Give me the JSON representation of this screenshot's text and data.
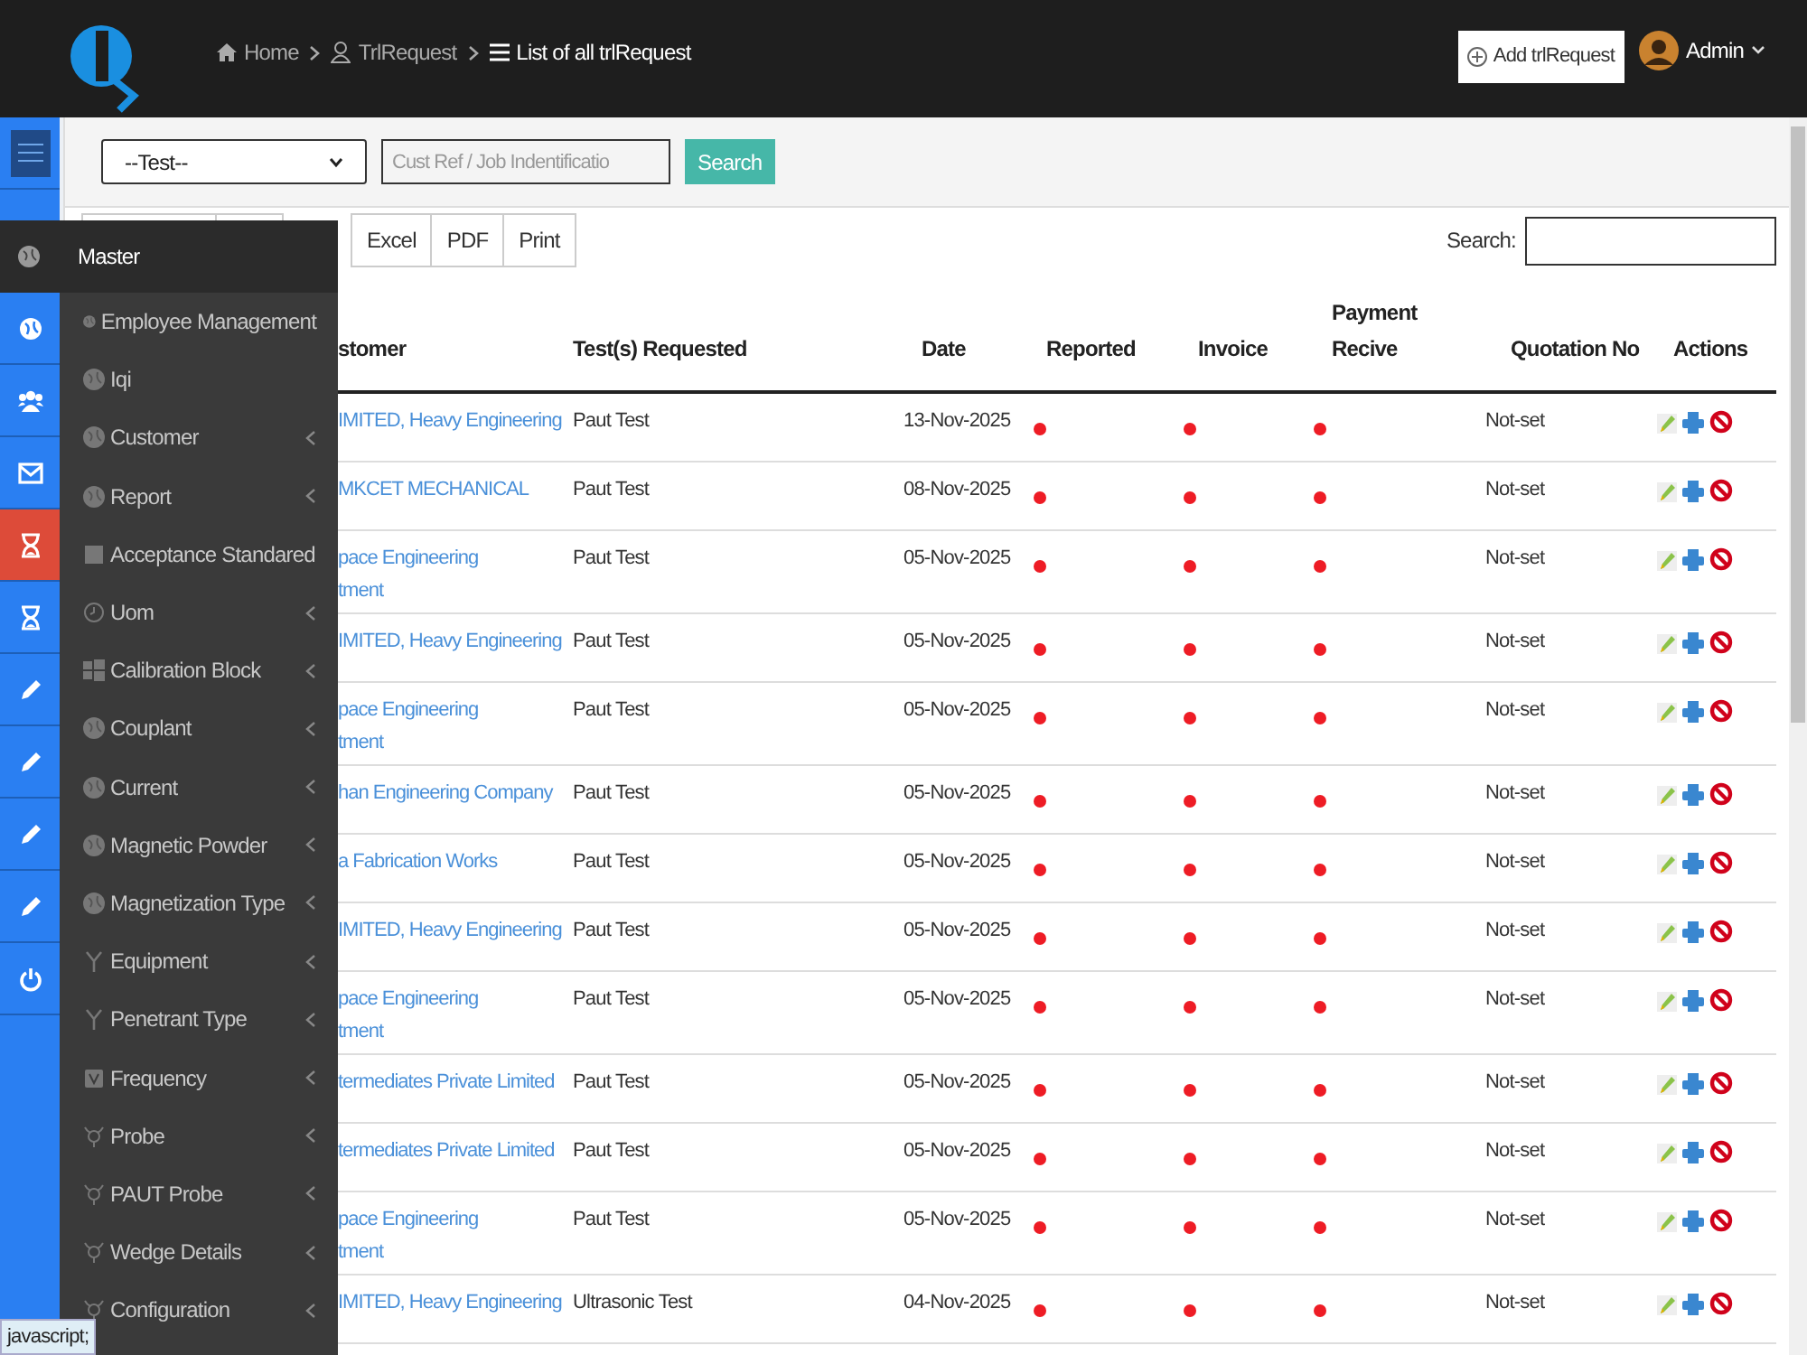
{
  "breadcrumbs": [
    {
      "label": "Home",
      "kind": "home",
      "current": false
    },
    {
      "label": "TrlRequest",
      "kind": "user",
      "current": false
    },
    {
      "label": "List of all trlRequest",
      "kind": "list",
      "current": true
    }
  ],
  "add_button": "Add trlRequest",
  "user": {
    "name": "Admin"
  },
  "rail": [
    {
      "kind": "globe",
      "selected": false
    },
    {
      "kind": "users",
      "selected": false
    },
    {
      "kind": "mail",
      "selected": false
    },
    {
      "kind": "hourglass",
      "selected": true
    },
    {
      "kind": "hourglass",
      "selected": false
    },
    {
      "kind": "pencil",
      "selected": false
    },
    {
      "kind": "pencil",
      "selected": false
    },
    {
      "kind": "pencil",
      "selected": false
    },
    {
      "kind": "pencil",
      "selected": false
    },
    {
      "kind": "power",
      "selected": false
    }
  ],
  "menu": {
    "title": "Master",
    "items": [
      {
        "label": "Employee Management",
        "kind": "globe",
        "submenu": false
      },
      {
        "label": "Iqi",
        "kind": "globe",
        "submenu": false
      },
      {
        "label": "Customer",
        "kind": "globe",
        "submenu": true
      },
      {
        "label": "Report",
        "kind": "globe",
        "submenu": true
      },
      {
        "label": "Acceptance Standared",
        "kind": "square",
        "submenu": false
      },
      {
        "label": "Uom",
        "kind": "clock",
        "submenu": true
      },
      {
        "label": "Calibration Block",
        "kind": "windows",
        "submenu": true
      },
      {
        "label": "Couplant",
        "kind": "globe",
        "submenu": true
      },
      {
        "label": "Current",
        "kind": "globe",
        "submenu": true
      },
      {
        "label": "Magnetic Powder",
        "kind": "globe",
        "submenu": true
      },
      {
        "label": "Magnetization Type",
        "kind": "globe",
        "submenu": true
      },
      {
        "label": "Equipment",
        "kind": "fork",
        "submenu": true
      },
      {
        "label": "Penetrant Type",
        "kind": "fork",
        "submenu": true
      },
      {
        "label": "Frequency",
        "kind": "badge",
        "submenu": true
      },
      {
        "label": "Probe",
        "kind": "bulb",
        "submenu": true
      },
      {
        "label": "PAUT Probe",
        "kind": "bulb",
        "submenu": true
      },
      {
        "label": "Wedge Details",
        "kind": "bulb",
        "submenu": true
      },
      {
        "label": "Configuration",
        "kind": "bulb",
        "submenu": true
      }
    ]
  },
  "filters": {
    "select": "--Test--",
    "placeholder": "Cust Ref / Job Indentificatio",
    "button": "Search"
  },
  "export_buttons": [
    "Excel",
    "PDF",
    "Print"
  ],
  "table_search": {
    "label": "Search:"
  },
  "table": {
    "columns": [
      "stomer",
      "Test(s) Requested",
      "Date",
      "Reported",
      "Invoice",
      "Payment Recive",
      "Quotation No",
      "Actions"
    ],
    "rows": [
      {
        "customer": [
          "IMITED, Heavy Engineering"
        ],
        "tests": "Paut Test",
        "date": "13-Nov-2025",
        "reported": false,
        "invoice": false,
        "payment": false,
        "quotation": "Not-set"
      },
      {
        "customer": [
          "MKCET MECHANICAL"
        ],
        "tests": "Paut Test",
        "date": "08-Nov-2025",
        "reported": false,
        "invoice": false,
        "payment": false,
        "quotation": "Not-set"
      },
      {
        "customer": [
          "pace Engineering",
          "tment"
        ],
        "tests": "Paut Test",
        "date": "05-Nov-2025",
        "reported": false,
        "invoice": false,
        "payment": false,
        "quotation": "Not-set"
      },
      {
        "customer": [
          "IMITED, Heavy Engineering"
        ],
        "tests": "Paut Test",
        "date": "05-Nov-2025",
        "reported": false,
        "invoice": false,
        "payment": false,
        "quotation": "Not-set"
      },
      {
        "customer": [
          "pace Engineering",
          "tment"
        ],
        "tests": "Paut Test",
        "date": "05-Nov-2025",
        "reported": false,
        "invoice": false,
        "payment": false,
        "quotation": "Not-set"
      },
      {
        "customer": [
          "han Engineering Company"
        ],
        "tests": "Paut Test",
        "date": "05-Nov-2025",
        "reported": false,
        "invoice": false,
        "payment": false,
        "quotation": "Not-set"
      },
      {
        "customer": [
          "a Fabrication Works"
        ],
        "tests": "Paut Test",
        "date": "05-Nov-2025",
        "reported": false,
        "invoice": false,
        "payment": false,
        "quotation": "Not-set"
      },
      {
        "customer": [
          "IMITED, Heavy Engineering"
        ],
        "tests": "Paut Test",
        "date": "05-Nov-2025",
        "reported": false,
        "invoice": false,
        "payment": false,
        "quotation": "Not-set"
      },
      {
        "customer": [
          "pace Engineering",
          "tment"
        ],
        "tests": "Paut Test",
        "date": "05-Nov-2025",
        "reported": false,
        "invoice": false,
        "payment": false,
        "quotation": "Not-set"
      },
      {
        "customer": [
          "termediates Private Limited"
        ],
        "tests": "Paut Test",
        "date": "05-Nov-2025",
        "reported": false,
        "invoice": false,
        "payment": false,
        "quotation": "Not-set"
      },
      {
        "customer": [
          "termediates Private Limited"
        ],
        "tests": "Paut Test",
        "date": "05-Nov-2025",
        "reported": false,
        "invoice": false,
        "payment": false,
        "quotation": "Not-set"
      },
      {
        "customer": [
          "pace Engineering",
          "tment"
        ],
        "tests": "Paut Test",
        "date": "05-Nov-2025",
        "reported": false,
        "invoice": false,
        "payment": false,
        "quotation": "Not-set"
      },
      {
        "customer": [
          "IMITED, Heavy Engineering"
        ],
        "tests": "Ultrasonic Test",
        "date": "04-Nov-2025",
        "reported": false,
        "invoice": false,
        "payment": false,
        "quotation": "Not-set"
      }
    ]
  },
  "status_bar": "javascript;"
}
